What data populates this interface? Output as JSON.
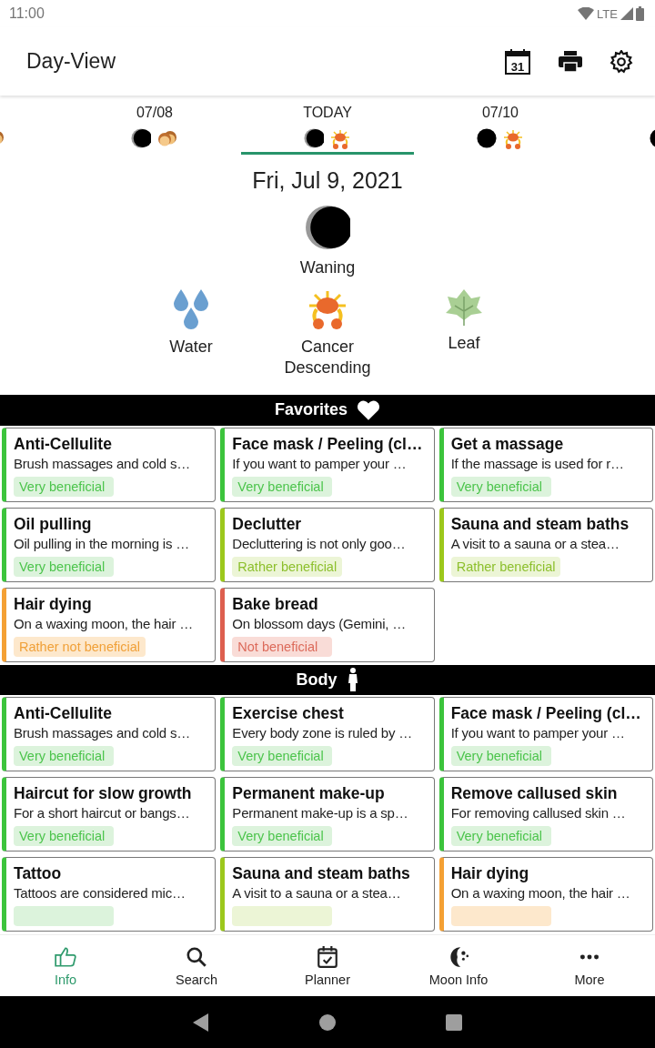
{
  "status_bar": {
    "time": "11:00",
    "network": "LTE"
  },
  "app_bar": {
    "title": "Day-View",
    "actions": [
      {
        "kind": "calendar",
        "label": "31"
      },
      {
        "kind": "print"
      },
      {
        "kind": "settings"
      }
    ]
  },
  "days": [
    {
      "icons": [
        {
          "kind": "gemini"
        }
      ],
      "selected": false
    },
    {
      "label": "07/08",
      "icons": [
        {
          "kind": "waning"
        },
        {
          "kind": "gemini"
        }
      ],
      "selected": false
    },
    {
      "label": "TODAY",
      "icons": [
        {
          "kind": "waning"
        },
        {
          "kind": "cancer"
        }
      ],
      "selected": true
    },
    {
      "label": "07/10",
      "icons": [
        {
          "kind": "new"
        },
        {
          "kind": "cancer"
        }
      ],
      "selected": false
    },
    {
      "icons": [
        {
          "kind": "new"
        }
      ],
      "selected": false
    }
  ],
  "date": "Fri, Jul 9, 2021",
  "moon_phase": {
    "kind": "waning",
    "label": "Waning"
  },
  "attributes": [
    {
      "kind": "water",
      "label": "Water"
    },
    {
      "kind": "cancer",
      "label": "Cancer\nDescending"
    },
    {
      "kind": "leaf",
      "label": "Leaf"
    }
  ],
  "sections": [
    {
      "title": "Favorites",
      "kind": "favorites",
      "cards": [
        {
          "title": "Anti-Cellulite",
          "text": "Brush massages and cold s…",
          "kind": "very",
          "badge": "Very beneficial"
        },
        {
          "title": "Face mask / Peeling (cl…",
          "text": "If you want to pamper your …",
          "kind": "very",
          "badge": "Very beneficial"
        },
        {
          "title": "Get a massage",
          "text": "If the massage is used for r…",
          "kind": "very",
          "badge": "Very beneficial"
        },
        {
          "title": "Oil pulling",
          "text": "Oil pulling in the morning is …",
          "kind": "very",
          "badge": "Very beneficial"
        },
        {
          "title": "Declutter",
          "text": "Decluttering is not only goo…",
          "kind": "rather",
          "badge": "Rather beneficial"
        },
        {
          "title": "Sauna and steam baths",
          "text": "A visit to a sauna or a stea…",
          "kind": "rather",
          "badge": "Rather beneficial"
        },
        {
          "title": "Hair dying",
          "text": "On a waxing moon, the hair …",
          "kind": "rather_not",
          "badge": "Rather not beneficial"
        },
        {
          "title": "Bake bread",
          "text": "On blossom days (Gemini, …",
          "kind": "not",
          "badge": "Not beneficial"
        }
      ]
    },
    {
      "title": "Body",
      "kind": "body",
      "cards": [
        {
          "title": "Anti-Cellulite",
          "text": "Brush massages and cold s…",
          "kind": "very",
          "badge": "Very beneficial"
        },
        {
          "title": "Exercise chest",
          "text": "Every body zone is ruled by …",
          "kind": "very",
          "badge": "Very beneficial"
        },
        {
          "title": "Face mask / Peeling (cl…",
          "text": "If you want to pamper your …",
          "kind": "very",
          "badge": "Very beneficial"
        },
        {
          "title": "Haircut for slow growth",
          "text": "For a short haircut or bangs…",
          "kind": "very",
          "badge": "Very beneficial"
        },
        {
          "title": "Permanent make-up",
          "text": "Permanent make-up is a sp…",
          "kind": "very",
          "badge": "Very beneficial"
        },
        {
          "title": "Remove callused skin",
          "text": "For removing callused skin …",
          "kind": "very",
          "badge": "Very beneficial"
        },
        {
          "title": "Tattoo",
          "text": "Tattoos are considered mic…",
          "kind": "very"
        },
        {
          "title": "Sauna and steam baths",
          "text": "A visit to a sauna or a stea…",
          "kind": "rather"
        },
        {
          "title": "Hair dying",
          "text": "On a waxing moon, the hair …",
          "kind": "rather_not"
        }
      ]
    }
  ],
  "bottom_nav": [
    {
      "kind": "info",
      "label": "Info",
      "selected": true
    },
    {
      "kind": "search",
      "label": "Search",
      "selected": false
    },
    {
      "kind": "planner",
      "label": "Planner",
      "selected": false
    },
    {
      "kind": "moon",
      "label": "Moon Info",
      "selected": false
    },
    {
      "kind": "more",
      "label": "More",
      "selected": false
    }
  ]
}
